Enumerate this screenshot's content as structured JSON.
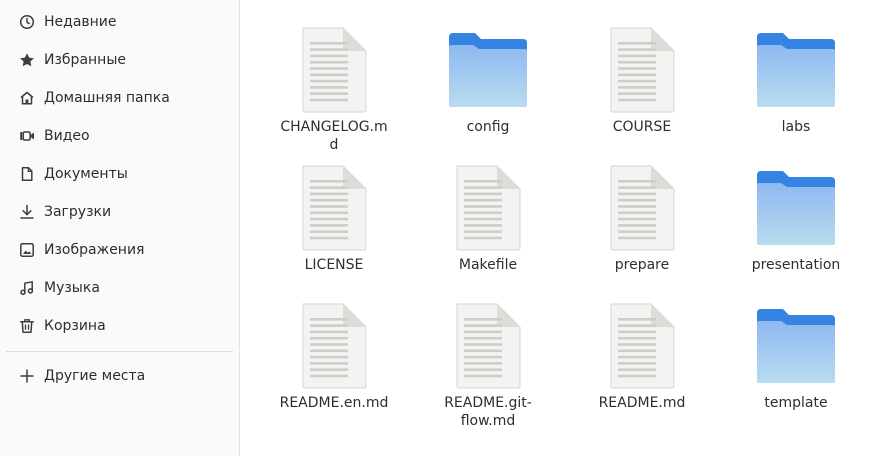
{
  "sidebar": {
    "items": [
      {
        "label": "Недавние",
        "icon": "clock-icon"
      },
      {
        "label": "Избранные",
        "icon": "star-icon"
      },
      {
        "label": "Домашняя папка",
        "icon": "home-icon"
      },
      {
        "label": "Видео",
        "icon": "video-icon"
      },
      {
        "label": "Документы",
        "icon": "document-icon"
      },
      {
        "label": "Загрузки",
        "icon": "download-icon"
      },
      {
        "label": "Изображения",
        "icon": "image-icon"
      },
      {
        "label": "Музыка",
        "icon": "music-icon"
      },
      {
        "label": "Корзина",
        "icon": "trash-icon"
      }
    ],
    "other_places": {
      "label": "Другие места",
      "icon": "plus-icon"
    }
  },
  "files": [
    {
      "name": "CHANGELOG.md",
      "type": "file"
    },
    {
      "name": "config",
      "type": "folder"
    },
    {
      "name": "COURSE",
      "type": "file"
    },
    {
      "name": "labs",
      "type": "folder"
    },
    {
      "name": "LICENSE",
      "type": "file"
    },
    {
      "name": "Makefile",
      "type": "file"
    },
    {
      "name": "prepare",
      "type": "file"
    },
    {
      "name": "presentation",
      "type": "folder"
    },
    {
      "name": "README.en.md",
      "type": "file"
    },
    {
      "name": "README.git-flow.md",
      "type": "file"
    },
    {
      "name": "README.md",
      "type": "file"
    },
    {
      "name": "template",
      "type": "folder"
    }
  ],
  "colors": {
    "folder_tab": "#3584e4",
    "folder_front_top": "#8fb8f0",
    "folder_front_bottom": "#b8dcef",
    "file_page": "#f4f3f2",
    "file_lines": "#cfcdca"
  }
}
